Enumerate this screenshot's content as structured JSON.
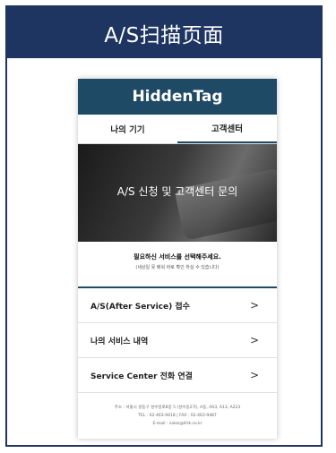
{
  "frame": {
    "title": "A/S扫描页面"
  },
  "app": {
    "brand": "HiddenTag",
    "tabs": [
      {
        "label": "나의 기기",
        "active": false
      },
      {
        "label": "고객센터",
        "active": true
      }
    ],
    "hero": {
      "text": "A/S 신청 및 고객센터 문의"
    },
    "notice": {
      "main": "필요하신 서비스를 선택해주세요.",
      "sub": "(세상일 못 배워 바로 확인 하실 수 있습니다)"
    },
    "menu": [
      {
        "label": "A/S(After Service) 접수",
        "chevron": ">"
      },
      {
        "label": "나의 서비스 내역",
        "chevron": ">"
      },
      {
        "label": "Service Center 전화 연결",
        "chevron": ">"
      }
    ],
    "footer": {
      "line1": "주소 : 서울시 성동구 성수일로8길 5 (성수동2가), A동, A03, A13, A223",
      "line2": "TEL : 02-463-9418 | FAX : 02-463-9487",
      "line3": "E-mail : sales@illrk.co.kr"
    }
  },
  "colors": {
    "frame": "#1e3461",
    "brand": "#1f4a66"
  }
}
